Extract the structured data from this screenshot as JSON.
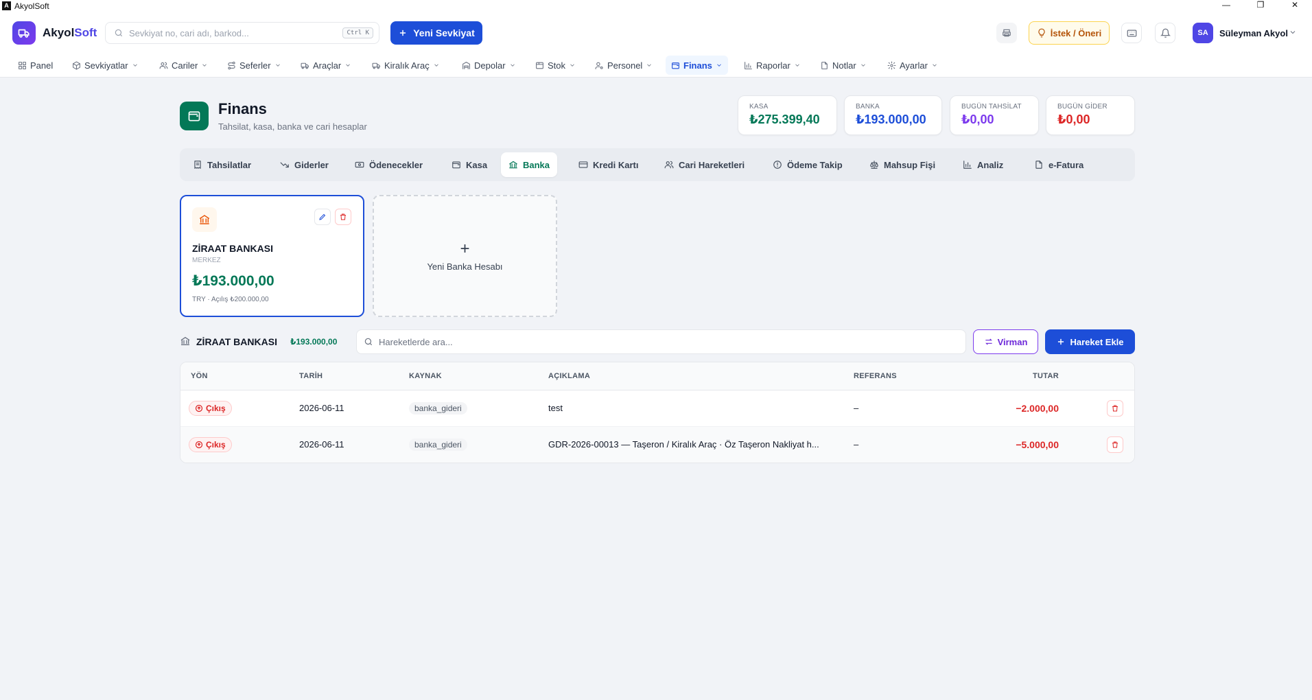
{
  "window": {
    "title": "AkyolSoft",
    "minimize": "—",
    "restore": "❐",
    "close": "✕"
  },
  "header": {
    "brand_main": "Akyol",
    "brand_accent": "Soft",
    "search_placeholder": "Sevkiyat no, cari adı, barkod...",
    "search_shortcut": "Ctrl K",
    "new_shipment_label": "Yeni Sevkiyat",
    "suggestion_label": "İstek / Öneri",
    "user_initials": "SA",
    "user_name": "Süleyman Akyol"
  },
  "nav": {
    "items": [
      {
        "label": "Panel",
        "icon": "grid-icon"
      },
      {
        "label": "Sevkiyatlar",
        "icon": "box-icon"
      },
      {
        "label": "Cariler",
        "icon": "users-icon"
      },
      {
        "label": "Seferler",
        "icon": "route-icon"
      },
      {
        "label": "Araçlar",
        "icon": "truck-icon"
      },
      {
        "label": "Kiralık Araç",
        "icon": "truck-icon"
      },
      {
        "label": "Depolar",
        "icon": "warehouse-icon"
      },
      {
        "label": "Stok",
        "icon": "package-icon"
      },
      {
        "label": "Personel",
        "icon": "user-cog-icon"
      },
      {
        "label": "Finans",
        "icon": "wallet-icon",
        "active": true
      },
      {
        "label": "Raporlar",
        "icon": "bar-chart-icon"
      },
      {
        "label": "Notlar",
        "icon": "file-icon"
      },
      {
        "label": "Ayarlar",
        "icon": "gear-icon"
      }
    ]
  },
  "page": {
    "title": "Finans",
    "subtitle": "Tahsilat, kasa, banka ve cari hesaplar"
  },
  "stats": [
    {
      "label": "KASA",
      "value": "₺275.399,40",
      "color": "#047857"
    },
    {
      "label": "BANKA",
      "value": "₺193.000,00",
      "color": "#1d4ed8"
    },
    {
      "label": "BUGÜN TAHSİLAT",
      "value": "₺0,00",
      "color": "#7c3aed"
    },
    {
      "label": "BUGÜN GİDER",
      "value": "₺0,00",
      "color": "#dc2626"
    }
  ],
  "tabs": [
    {
      "label": "Tahsilatlar",
      "icon": "receipt-icon"
    },
    {
      "label": "Giderler",
      "icon": "trending-down-icon"
    },
    {
      "label": "Ödenecekler",
      "icon": "banknote-icon"
    },
    {
      "label": "Kasa",
      "icon": "wallet-icon"
    },
    {
      "label": "Banka",
      "icon": "bank-icon",
      "active": true
    },
    {
      "label": "Kredi Kartı",
      "icon": "credit-card-icon"
    },
    {
      "label": "Cari Hareketleri",
      "icon": "users-icon"
    },
    {
      "label": "Ödeme Takip",
      "icon": "alert-circle-icon"
    },
    {
      "label": "Mahsup Fişi",
      "icon": "scale-icon"
    },
    {
      "label": "Analiz",
      "icon": "bar-chart-icon"
    },
    {
      "label": "e-Fatura",
      "icon": "file-icon"
    }
  ],
  "bank_card": {
    "name": "ZİRAAT BANKASI",
    "branch": "MERKEZ",
    "balance": "₺193.000,00",
    "meta": "TRY · Açılış ₺200.000,00"
  },
  "new_bank": {
    "plus": "+",
    "label": "Yeni Banka Hesabı"
  },
  "account_bar": {
    "name": "ZİRAAT BANKASI",
    "balance": "₺193.000,00",
    "search_placeholder": "Hareketlerde ara...",
    "transfer_label": "Virman",
    "add_label": "Hareket Ekle"
  },
  "table": {
    "columns": [
      "YÖN",
      "TARİH",
      "KAYNAK",
      "AÇIKLAMA",
      "REFERANS",
      "TUTAR"
    ],
    "rows": [
      {
        "direction": "Çıkış",
        "date": "2026-06-11",
        "source": "banka_gideri",
        "description": "test",
        "reference": "–",
        "amount": "−2.000,00"
      },
      {
        "direction": "Çıkış",
        "date": "2026-06-11",
        "source": "banka_gideri",
        "description": "GDR-2026-00013 — Taşeron / Kiralık Araç · Öz Taşeron Nakliyat h...",
        "reference": "–",
        "amount": "−5.000,00"
      }
    ]
  }
}
